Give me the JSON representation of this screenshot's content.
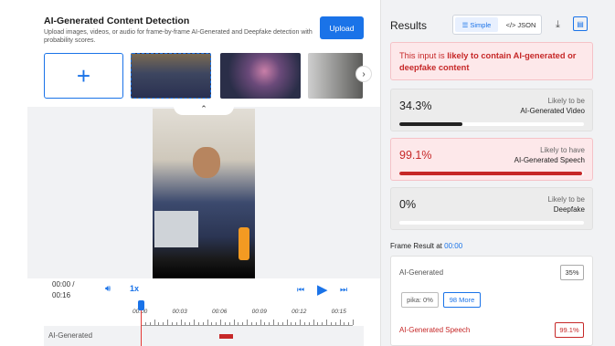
{
  "header": {
    "title": "AI-Generated Content Detection",
    "description": "Upload images, videos, or audio for frame-by-frame AI-Generated and Deepfake detection with probability scores.",
    "upload_label": "Upload"
  },
  "gallery": {
    "add_glyph": "+",
    "next_glyph": "›"
  },
  "player": {
    "current_time": "00:00 /",
    "duration": "00:16",
    "speed": "1x",
    "collapse_glyph": "⌃"
  },
  "timeline": {
    "tick_labels": [
      "00:00",
      "00:03",
      "00:06",
      "00:09",
      "00:12",
      "00:15"
    ],
    "track_label": "AI-Generated"
  },
  "results": {
    "title": "Results",
    "view_simple": "Simple",
    "view_json": "JSON",
    "alert_prefix": "This input is ",
    "alert_emphasis": "likely to contain AI-generated or deepfake content",
    "cards": [
      {
        "percent": "34.3%",
        "line1": "Likely to be",
        "line2": "AI-Generated Video",
        "value": 0.343,
        "highlight": false
      },
      {
        "percent": "99.1%",
        "line1": "Likely to have",
        "line2": "AI-Generated Speech",
        "value": 0.991,
        "highlight": true
      },
      {
        "percent": "0%",
        "line1": "Likely to be",
        "line2": "Deepfake",
        "value": 0.0,
        "highlight": false
      }
    ],
    "frame_result_label": "Frame Result at ",
    "frame_result_time": "00:00",
    "frame": {
      "ai_label": "AI-Generated",
      "ai_value": "35%",
      "chip": "pika: 0%",
      "more": "98 More",
      "speech_label": "AI-Generated Speech",
      "speech_value": "99.1%"
    }
  },
  "colors": {
    "accent": "#1a73e8",
    "alert": "#c62828",
    "panel": "#f1f2f4"
  }
}
